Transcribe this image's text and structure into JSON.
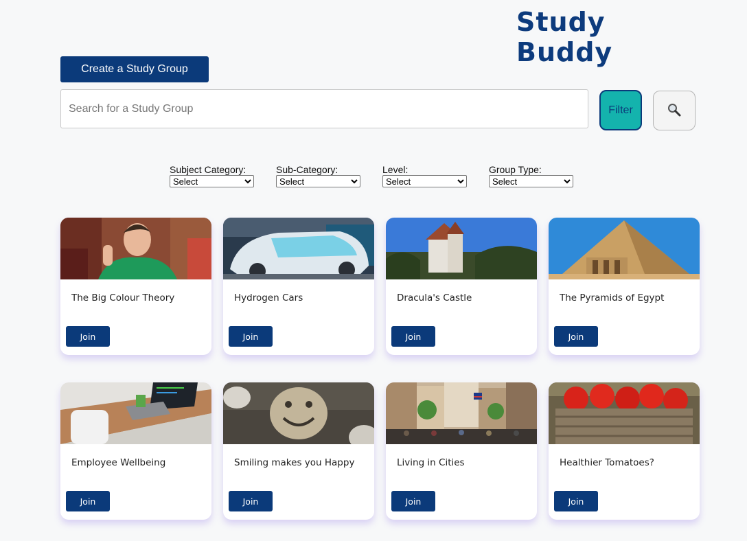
{
  "header": {
    "brand": "Study Buddy"
  },
  "toolbar": {
    "create_label": "Create a Study Group",
    "filter_label": "Filter",
    "search_icon": "magnifier-icon"
  },
  "search": {
    "placeholder": "Search for a Study Group"
  },
  "filters": [
    {
      "label": "Subject Category:",
      "selected": "Select"
    },
    {
      "label": "Sub-Category:",
      "selected": "Select"
    },
    {
      "label": "Level:",
      "selected": "Select"
    },
    {
      "label": "Group Type:",
      "selected": "Select"
    }
  ],
  "groups": [
    {
      "title": "The Big Colour Theory",
      "join": "Join",
      "image": "man-green-shirt-photo"
    },
    {
      "title": "Hydrogen Cars",
      "join": "Join",
      "image": "concept-car-photo"
    },
    {
      "title": "Dracula's Castle",
      "join": "Join",
      "image": "castle-photo"
    },
    {
      "title": "The Pyramids of Egypt",
      "join": "Join",
      "image": "pyramid-photo"
    },
    {
      "title": "Employee Wellbeing",
      "join": "Join",
      "image": "laptop-desk-photo"
    },
    {
      "title": "Smiling makes you Happy",
      "join": "Join",
      "image": "smiley-pavement-photo"
    },
    {
      "title": "Living in Cities",
      "join": "Join",
      "image": "city-street-photo"
    },
    {
      "title": "Healthier Tomatoes?",
      "join": "Join",
      "image": "tomato-basket-photo"
    }
  ],
  "colors": {
    "primary": "#0b3a7a",
    "brand": "#0d3b7d",
    "accent": "#14b3ad",
    "background": "#f7f8f9"
  }
}
